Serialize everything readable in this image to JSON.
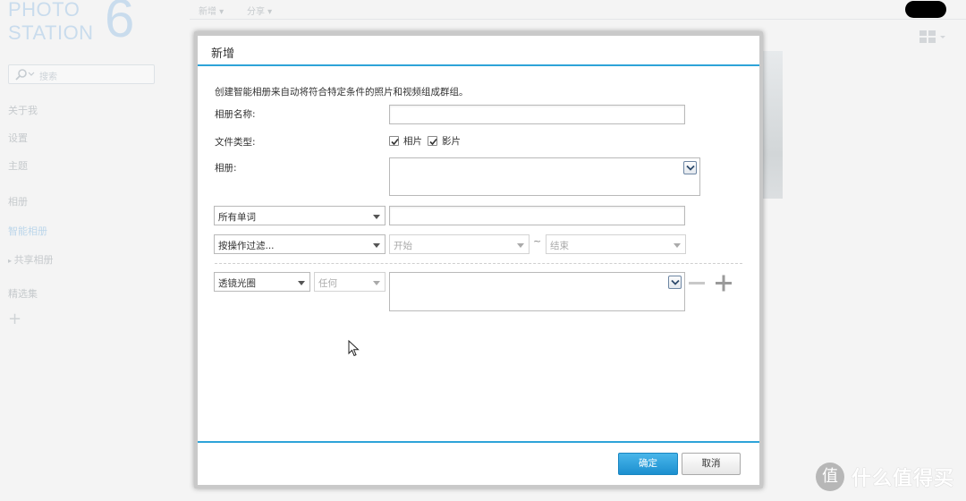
{
  "app": {
    "logo_line1": "PHOTO",
    "logo_line2": "STATION",
    "logo_number": "6",
    "search_placeholder": "搜索",
    "nav": {
      "about": "关于我",
      "settings": "设置",
      "theme": "主题",
      "albums": "相册",
      "smart_albums": "智能相册",
      "shared_albums": "共享相册",
      "featured": "精选集"
    },
    "top_menu": {
      "new": "新增",
      "share": "分享"
    }
  },
  "dialog": {
    "title": "新增",
    "intro": "创建智能相册来自动将符合特定条件的照片和视频组成群组。",
    "album_name_label": "相册名称:",
    "album_name_value": "",
    "file_type_label": "文件类型:",
    "file_types": [
      {
        "label": "相片",
        "checked": true
      },
      {
        "label": "影片",
        "checked": true
      }
    ],
    "album_label": "相册:",
    "album_value": "",
    "keyword_select": "所有单词",
    "keyword_value": "",
    "filter_select": "按操作过滤...",
    "range_start": "开始",
    "range_tilde": "~",
    "range_end": "结束",
    "condition_select": "透镜光圈",
    "condition_operator": "任何",
    "condition_value": "",
    "ok_label": "确定",
    "cancel_label": "取消"
  },
  "watermark": {
    "badge": "值",
    "text": "什么值得买"
  },
  "colors": {
    "accent": "#2ea3d8",
    "primary_button": "#2ea3d8"
  }
}
